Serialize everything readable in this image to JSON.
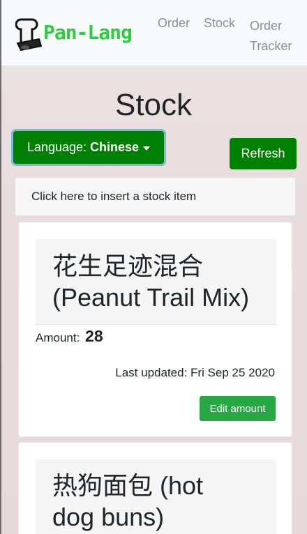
{
  "navbar": {
    "brand": "Pan-Lang",
    "links": [
      {
        "label": "Order"
      },
      {
        "label": "Stock"
      },
      {
        "label": "Order",
        "label2": "Tracker"
      }
    ]
  },
  "page": {
    "title": "Stock"
  },
  "language": {
    "prefix": "Language:",
    "current": "Chinese"
  },
  "refresh_label": "Refresh",
  "insert_label": "Click here to insert a stock item",
  "items": [
    {
      "name_zh": "花生足迹混合",
      "name_en": "(Peanut Trail Mix)",
      "amount_label": "Amount:",
      "amount": "28",
      "updated": "Last updated: Fri Sep 25 2020",
      "edit_label": "Edit amount"
    },
    {
      "name_zh": "热狗面包 (hot",
      "name_en": "dog buns)"
    }
  ],
  "colors": {
    "brand": "#2ecc40",
    "primary_button": "#008000",
    "edit_button": "#28a745"
  }
}
